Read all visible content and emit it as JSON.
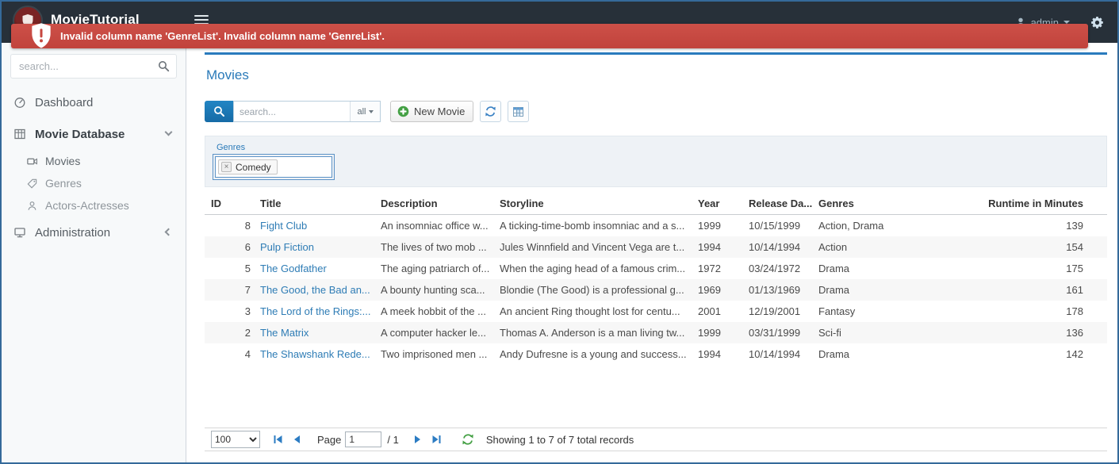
{
  "navbar": {
    "brand": "MovieTutorial",
    "user_label": "admin"
  },
  "alert": {
    "message": "Invalid column name 'GenreList'. Invalid column name 'GenreList'."
  },
  "sidebar": {
    "search_placeholder": "search...",
    "items": {
      "dashboard": "Dashboard",
      "movie_database": "Movie Database",
      "movies": "Movies",
      "genres": "Genres",
      "actors": "Actors-Actresses",
      "administration": "Administration"
    }
  },
  "main": {
    "title": "Movies",
    "toolbar": {
      "search_placeholder": "search...",
      "search_scope": "all",
      "new_movie": "New Movie"
    },
    "filter": {
      "label": "Genres",
      "chip_remove": "×",
      "chip": "Comedy"
    },
    "table": {
      "columns": [
        "ID",
        "Title",
        "Description",
        "Storyline",
        "Year",
        "Release Da...",
        "Genres",
        "Runtime in Minutes"
      ],
      "rows": [
        {
          "id": "8",
          "title": "Fight Club",
          "description": "An insomniac office w...",
          "storyline": "A ticking-time-bomb insomniac and a s...",
          "year": "1999",
          "release_date": "10/15/1999",
          "genres": "Action, Drama",
          "runtime": "139"
        },
        {
          "id": "6",
          "title": "Pulp Fiction",
          "description": "The lives of two mob ...",
          "storyline": "Jules Winnfield and Vincent Vega are t...",
          "year": "1994",
          "release_date": "10/14/1994",
          "genres": "Action",
          "runtime": "154"
        },
        {
          "id": "5",
          "title": "The Godfather",
          "description": "The aging patriarch of...",
          "storyline": "When the aging head of a famous crim...",
          "year": "1972",
          "release_date": "03/24/1972",
          "genres": "Drama",
          "runtime": "175"
        },
        {
          "id": "7",
          "title": "The Good, the Bad an...",
          "description": "A bounty hunting sca...",
          "storyline": "Blondie (The Good) is a professional g...",
          "year": "1969",
          "release_date": "01/13/1969",
          "genres": "Drama",
          "runtime": "161"
        },
        {
          "id": "3",
          "title": "The Lord of the Rings:...",
          "description": "A meek hobbit of the ...",
          "storyline": "An ancient Ring thought lost for centu...",
          "year": "2001",
          "release_date": "12/19/2001",
          "genres": "Fantasy",
          "runtime": "178"
        },
        {
          "id": "2",
          "title": "The Matrix",
          "description": "A computer hacker le...",
          "storyline": "Thomas A. Anderson is a man living tw...",
          "year": "1999",
          "release_date": "03/31/1999",
          "genres": "Sci-fi",
          "runtime": "136"
        },
        {
          "id": "4",
          "title": "The Shawshank Rede...",
          "description": "Two imprisoned men ...",
          "storyline": "Andy Dufresne is a young and success...",
          "year": "1994",
          "release_date": "10/14/1994",
          "genres": "Drama",
          "runtime": "142"
        }
      ]
    },
    "pager": {
      "page_size": "100",
      "page_label": "Page",
      "current_page": "1",
      "of_pages": "/ 1",
      "status": "Showing 1 to 7 of 7 total records"
    }
  },
  "icons": {
    "brand-logo-icon": "shield-badge",
    "hamburger-icon": "three-bars",
    "user-icon": "person-silhouette",
    "caret-down-icon": "triangle-down",
    "gears-icon": "gear",
    "alert-shield-icon": "shield-exclamation",
    "search-icon": "magnifier",
    "dashboard-icon": "gauge",
    "movie-database-icon": "grid-table",
    "movies-icon": "video-camera",
    "genres-icon": "tag",
    "actors-icon": "person",
    "administration-icon": "monitor",
    "chevron-down-icon": "chevron-down",
    "chevron-left-icon": "chevron-left",
    "new-movie-icon": "plus-circle-green",
    "refresh-icon": "blue-circular-arrows",
    "column-picker-icon": "table-columns",
    "first-page-icon": "bar-left-triangle",
    "prev-page-icon": "left-triangle",
    "next-page-icon": "right-triangle",
    "last-page-icon": "right-triangle-bar",
    "pager-refresh-icon": "green-circular-arrows",
    "chip-remove-icon": "x-box"
  },
  "colors": {
    "navbar_bg": "#273039",
    "alert_red": "#c7473f",
    "accent_blue": "#2a7ab9",
    "link_blue": "#2e7cb5",
    "success_green": "#44a044",
    "frame_border": "#356a9a"
  }
}
